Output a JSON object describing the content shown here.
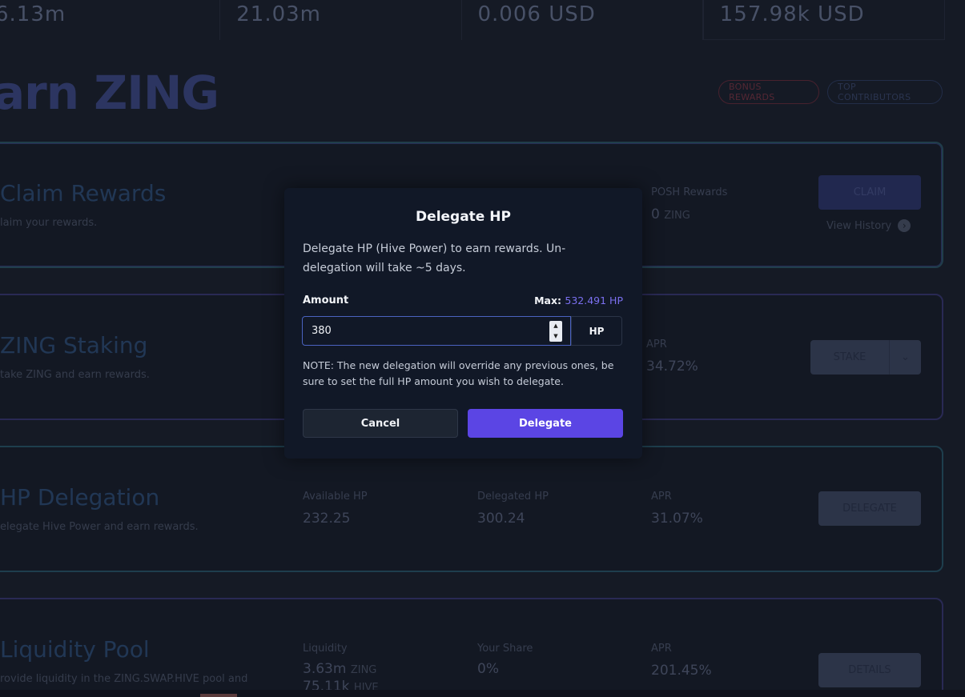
{
  "stats": [
    "6.13m",
    "21.03m",
    "0.006 USD",
    "157.98k USD"
  ],
  "page_title": "arn ZING",
  "pills": {
    "bonus": "BONUS REWARDS",
    "top": "TOP CONTRIBUTORS"
  },
  "cards": {
    "claim": {
      "title": "Claim Rewards",
      "desc": "laim your rewards.",
      "posh_label": "POSH Rewards",
      "posh_value": "0",
      "posh_unit": "ZING",
      "button": "CLAIM",
      "history": "View History"
    },
    "staking": {
      "title": "ZING Staking",
      "desc": "take ZING and earn rewards.",
      "apr_label": "APR",
      "apr_value": "34.72%",
      "button": "STAKE"
    },
    "delegation": {
      "title": "HP Delegation",
      "desc": "elegate Hive Power and earn rewards.",
      "available_label": "Available HP",
      "available_value": "232.25",
      "delegated_label": "Delegated HP",
      "delegated_value": "300.24",
      "apr_label": "APR",
      "apr_value": "31.07%",
      "button": "DELEGATE"
    },
    "liquidity": {
      "title": "Liquidity Pool",
      "desc": "rovide liquidity in the ZING.SWAP.HIVE pool and",
      "liquidity_label": "Liquidity",
      "liquidity_value": "3.63m",
      "liquidity_unit": "ZING",
      "liquidity_value2": "75.11k",
      "liquidity_unit2": "HIVE",
      "share_label": "Your Share",
      "share_value": "0%",
      "apr_label": "APR",
      "apr_value": "201.45%",
      "button": "DETAILS"
    }
  },
  "modal": {
    "title": "Delegate HP",
    "description": "Delegate HP (Hive Power) to earn rewards. Un-delegation will take ~5 days.",
    "amount_label": "Amount",
    "max_label": "Max:",
    "max_value": "532.491 HP",
    "amount_value": "380",
    "unit": "HP",
    "note": "NOTE: The new delegation will override any previous ones, be sure to set the full HP amount you wish to delegate.",
    "cancel": "Cancel",
    "confirm": "Delegate"
  },
  "colors": {
    "accent": "#5b45e4",
    "max_value": "#7b70f0"
  }
}
